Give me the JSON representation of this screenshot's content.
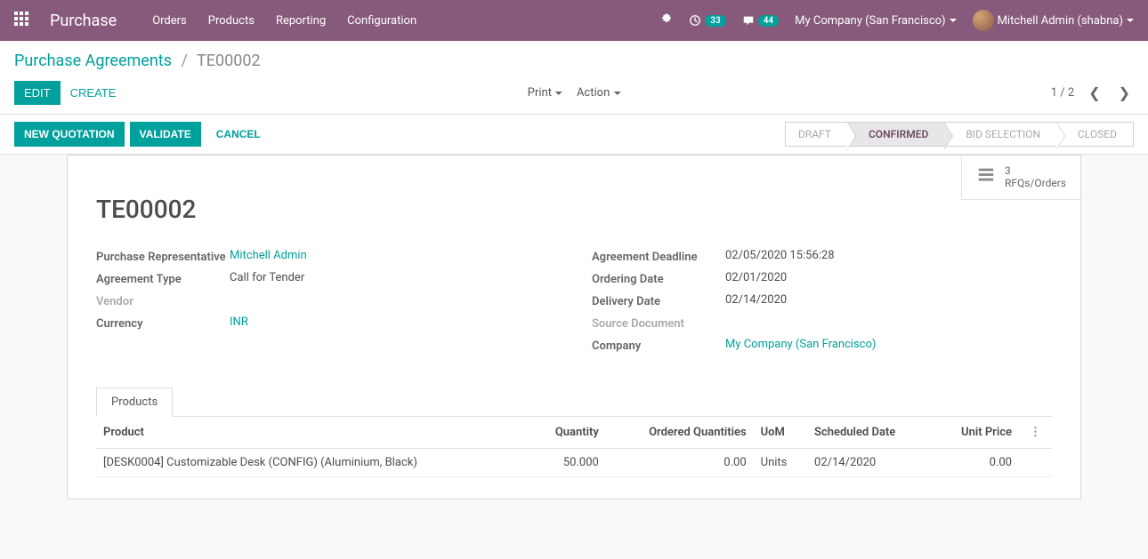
{
  "nav": {
    "brand": "Purchase",
    "menu": [
      "Orders",
      "Products",
      "Reporting",
      "Configuration"
    ],
    "activities_count": "33",
    "messages_count": "44",
    "company": "My Company (San Francisco)",
    "user": "Mitchell Admin (shabna)"
  },
  "breadcrumb": {
    "parent": "Purchase Agreements",
    "current": "TE00002"
  },
  "buttons": {
    "edit": "EDIT",
    "create": "CREATE",
    "print": "Print",
    "action": "Action",
    "new_quotation": "NEW QUOTATION",
    "validate": "VALIDATE",
    "cancel": "CANCEL"
  },
  "pager": {
    "text": "1 / 2"
  },
  "status": {
    "steps": [
      "DRAFT",
      "CONFIRMED",
      "BID SELECTION",
      "CLOSED"
    ],
    "active_index": 1
  },
  "stat": {
    "count": "3",
    "label": "RFQs/Orders"
  },
  "record": {
    "title": "TE00002",
    "left": {
      "rep_label": "Purchase Representative",
      "rep_value": "Mitchell Admin",
      "type_label": "Agreement Type",
      "type_value": "Call for Tender",
      "vendor_label": "Vendor",
      "vendor_value": "",
      "currency_label": "Currency",
      "currency_value": "INR"
    },
    "right": {
      "deadline_label": "Agreement Deadline",
      "deadline_value": "02/05/2020 15:56:28",
      "ordering_label": "Ordering Date",
      "ordering_value": "02/01/2020",
      "delivery_label": "Delivery Date",
      "delivery_value": "02/14/2020",
      "source_label": "Source Document",
      "source_value": "",
      "company_label": "Company",
      "company_value": "My Company (San Francisco)"
    }
  },
  "tabs": {
    "products": "Products"
  },
  "table": {
    "headers": {
      "product": "Product",
      "quantity": "Quantity",
      "ordered": "Ordered Quantities",
      "uom": "UoM",
      "scheduled": "Scheduled Date",
      "price": "Unit Price"
    },
    "rows": [
      {
        "product": "[DESK0004] Customizable Desk (CONFIG) (Aluminium, Black)",
        "quantity": "50.000",
        "ordered": "0.00",
        "uom": "Units",
        "scheduled": "02/14/2020",
        "price": "0.00"
      }
    ]
  }
}
